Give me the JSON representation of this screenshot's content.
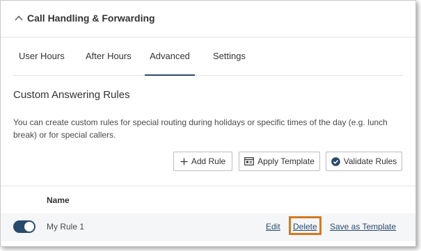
{
  "header": {
    "title": "Call Handling & Forwarding",
    "collapse_icon": "chevron-up-icon"
  },
  "tabs": [
    {
      "label": "User Hours",
      "active": false
    },
    {
      "label": "After Hours",
      "active": false
    },
    {
      "label": "Advanced",
      "active": true
    },
    {
      "label": "Settings",
      "active": false
    }
  ],
  "section": {
    "title": "Custom Answering Rules",
    "description": "You can create custom rules for special routing during holidays or specific times of the day (e.g. lunch break) or for special callers."
  },
  "toolbar": {
    "add_rule": {
      "label": "Add Rule",
      "icon": "plus-icon"
    },
    "apply_template": {
      "label": "Apply Template",
      "icon": "template-icon"
    },
    "validate_rules": {
      "label": "Validate Rules",
      "icon": "check-circle-icon"
    }
  },
  "table": {
    "columns": [
      "Name"
    ],
    "rows": [
      {
        "name": "My Rule 1",
        "enabled": true,
        "actions": {
          "edit": "Edit",
          "delete": "Delete",
          "save_template": "Save as Template"
        }
      }
    ]
  },
  "colors": {
    "accent": "#2a4a6c",
    "highlight": "#d5781e",
    "row_background": "#f5f6f8"
  }
}
